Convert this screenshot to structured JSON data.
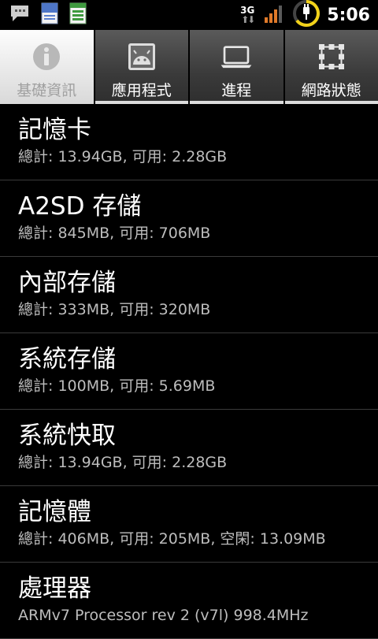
{
  "status_bar": {
    "network_type": "3G",
    "clock": "5:06",
    "icons": [
      "chat-icon",
      "blue-document-icon",
      "green-spreadsheet-icon",
      "network-3g-icon",
      "signal-strength-icon",
      "battery-charging-icon"
    ]
  },
  "tabs": [
    {
      "label": "基礎資訊",
      "icon": "info-icon",
      "active": true
    },
    {
      "label": "應用程式",
      "icon": "android-app-icon",
      "active": false
    },
    {
      "label": "進程",
      "icon": "laptop-icon",
      "active": false
    },
    {
      "label": "網路狀態",
      "icon": "network-grid-icon",
      "active": false
    }
  ],
  "items": [
    {
      "title": "記憶卡",
      "detail": "總計: 13.94GB, 可用: 2.28GB"
    },
    {
      "title": "A2SD 存儲",
      "detail": "總計: 845MB, 可用: 706MB"
    },
    {
      "title": "內部存儲",
      "detail": "總計: 333MB, 可用: 320MB"
    },
    {
      "title": "系統存儲",
      "detail": "總計: 100MB, 可用: 5.69MB"
    },
    {
      "title": "系統快取",
      "detail": "總計: 13.94GB, 可用: 2.28GB"
    },
    {
      "title": "記憶體",
      "detail": "總計: 406MB, 可用: 205MB, 空閑: 13.09MB"
    },
    {
      "title": "處理器",
      "detail": "ARMv7 Processor rev 2 (v7l)  998.4MHz"
    }
  ]
}
